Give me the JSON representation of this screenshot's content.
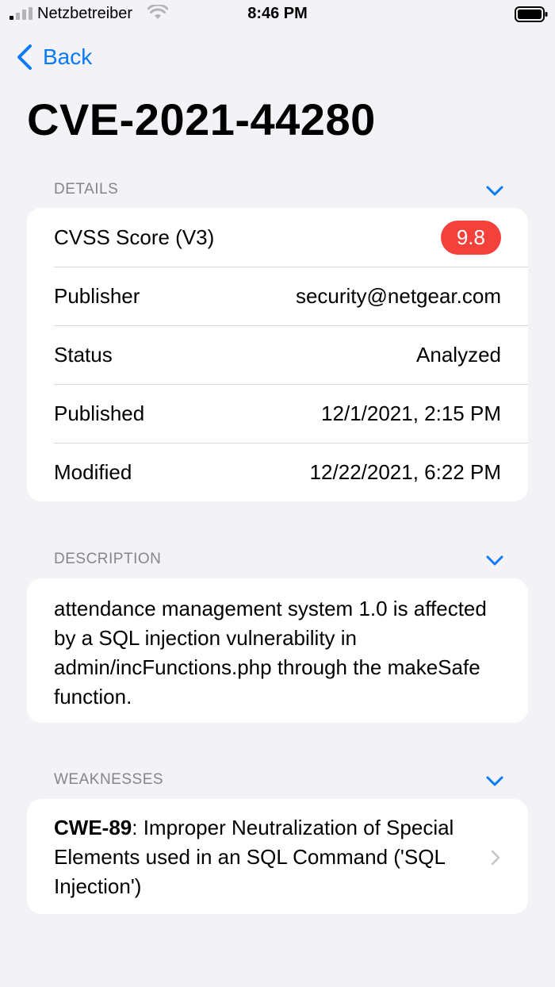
{
  "status_bar": {
    "carrier": "Netzbetreiber",
    "time": "8:46 PM"
  },
  "nav": {
    "back_label": "Back"
  },
  "page": {
    "title": "CVE-2021-44280"
  },
  "details": {
    "header": "DETAILS",
    "cvss_label": "CVSS Score  (V3)",
    "cvss_score": "9.8",
    "cvss_color": "#f4413c",
    "rows": [
      {
        "label": "Publisher",
        "value": "security@netgear.com"
      },
      {
        "label": "Status",
        "value": "Analyzed"
      },
      {
        "label": "Published",
        "value": "12/1/2021, 2:15 PM"
      },
      {
        "label": "Modified",
        "value": "12/22/2021, 6:22 PM"
      }
    ]
  },
  "description": {
    "header": "DESCRIPTION",
    "text": "attendance management system 1.0 is affected by a SQL injection vulnerability in admin/incFunctions.php through the makeSafe function."
  },
  "weaknesses": {
    "header": "WEAKNESSES",
    "items": [
      {
        "id": "CWE-89",
        "text": ": Improper Neutralization of Special Elements used in an SQL Command ('SQL Injection')"
      }
    ]
  },
  "colors": {
    "accent": "#0a7bf5",
    "background": "#f2f2f7",
    "secondary_text": "#85858b"
  }
}
